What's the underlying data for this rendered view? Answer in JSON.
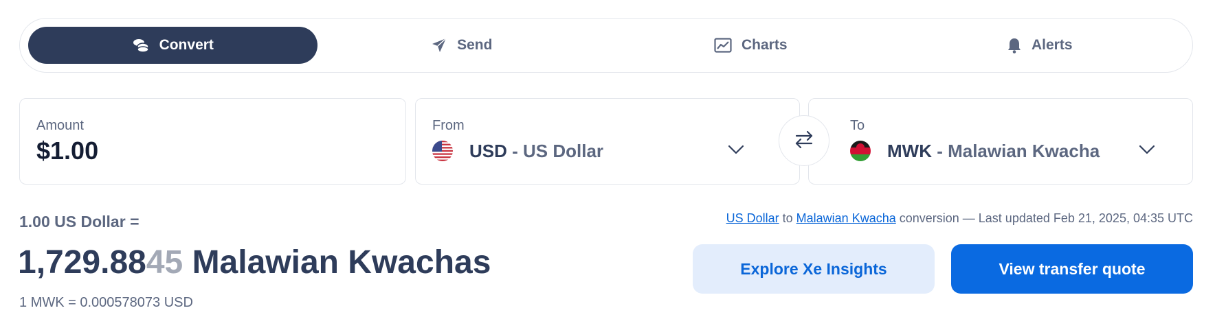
{
  "tabs": [
    {
      "label": "Convert",
      "icon": "coins-icon",
      "active": true
    },
    {
      "label": "Send",
      "icon": "paper-plane-icon",
      "active": false
    },
    {
      "label": "Charts",
      "icon": "line-chart-icon",
      "active": false
    },
    {
      "label": "Alerts",
      "icon": "bell-icon",
      "active": false
    }
  ],
  "amount": {
    "label": "Amount",
    "value": "$1.00"
  },
  "from": {
    "label": "From",
    "code": "USD",
    "separator": " - ",
    "name": "US Dollar",
    "flag": "us-flag-icon"
  },
  "to": {
    "label": "To",
    "code": "MWK",
    "separator": " - ",
    "name": "Malawian Kwacha",
    "flag": "malawi-flag-icon"
  },
  "swap": {
    "icon": "swap-arrows-icon"
  },
  "result": {
    "from_text": "1.00 US Dollar =",
    "amount_main": "1,729.88",
    "amount_faded": "45",
    "currency_text": " Malawian Kwachas",
    "inverse": "1 MWK = 0.000578073 USD"
  },
  "update": {
    "from_link": "US Dollar",
    "to_word": " to ",
    "to_link": "Malawian Kwacha",
    "rest": " conversion — Last updated Feb 21, 2025, 04:35 UTC"
  },
  "buttons": {
    "insights": "Explore Xe Insights",
    "quote": "View transfer quote"
  },
  "colors": {
    "tab_active": "#2e3c5a",
    "primary_blue": "#0a6ae1",
    "light_blue": "#e3edfc",
    "muted_text": "#5c6780"
  }
}
